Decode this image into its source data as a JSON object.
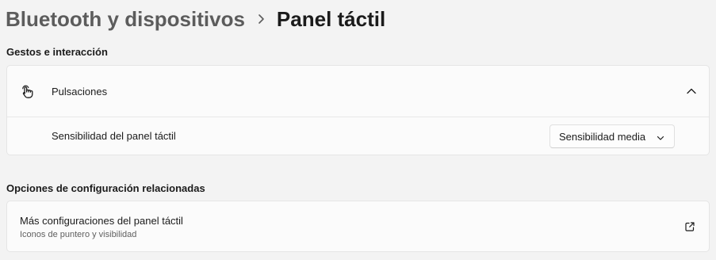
{
  "breadcrumb": {
    "parent": "Bluetooth y dispositivos",
    "separator_icon": "chevron-right-icon",
    "current": "Panel táctil"
  },
  "gestures_section": {
    "title": "Gestos e interacción",
    "taps": {
      "icon": "tap-gesture-icon",
      "label": "Pulsaciones",
      "expand_icon": "chevron-up-icon",
      "expanded": true
    },
    "sensitivity": {
      "label": "Sensibilidad del panel táctil",
      "selected": "Sensibilidad media",
      "dropdown_icon": "chevron-down-icon"
    }
  },
  "related_section": {
    "title": "Opciones de configuración relacionadas",
    "more_settings": {
      "label": "Más configuraciones del panel táctil",
      "description": "Iconos de puntero y visibilidad",
      "link_icon": "open-external-icon"
    }
  },
  "colors": {
    "background": "#f3f3f3",
    "card": "#fbfbfb",
    "border": "#e5e5e5",
    "text": "#1b1b1b",
    "secondary_text": "#606060",
    "breadcrumb_parent": "#5c5c5c"
  }
}
